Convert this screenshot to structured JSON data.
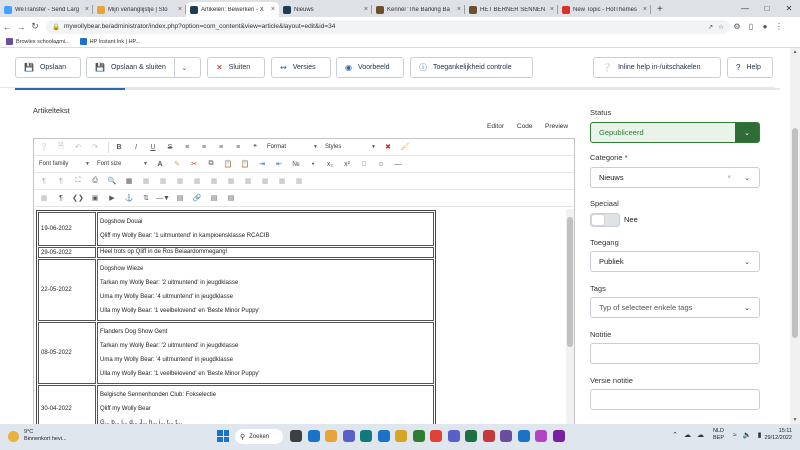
{
  "browser": {
    "tabs": [
      {
        "title": "WeTransfer - Send Larg",
        "color": "#409fff",
        "active": false
      },
      {
        "title": "Mijn verlanglijstje | Sto",
        "color": "#e8a33d",
        "active": false
      },
      {
        "title": "Artikelen: Bewerken - X",
        "color": "#1c3d5a",
        "active": true
      },
      {
        "title": "Nieuws",
        "color": "#1c3d5a",
        "active": false
      },
      {
        "title": "Kennel 'The Barking Ba",
        "color": "#6b4f2e",
        "active": false
      },
      {
        "title": "HET BERNER SENNEN",
        "color": "#6b4f2e",
        "active": false
      },
      {
        "title": "New Topic - HotThemes",
        "color": "#d93025",
        "active": false
      }
    ],
    "url": "mywollybear.be/administrator/index.php?option=com_content&view=article&layout=edit&id=34",
    "bookmarks": [
      {
        "label": "Browlex schoolaдmi...",
        "color": "#6b4f9e"
      },
      {
        "label": "HP Instant Ink | HP...",
        "color": "#1a73c8"
      }
    ]
  },
  "toolbar": {
    "save": "Opslaan",
    "save_close": "Opslaan & sluiten",
    "close": "Sluiten",
    "versions": "Versies",
    "preview": "Voorbeeld",
    "accessibility": "Toegankelijkheid controle",
    "inline_help": "Inline help in-/uitschakelen",
    "help": "Help"
  },
  "editor": {
    "section_label": "Artikeltekst",
    "view_tabs": [
      "Editor",
      "Code",
      "Preview"
    ],
    "format_select": "Format",
    "styles_select": "Styles",
    "font_family_select": "Font family",
    "font_size_select": "Font size"
  },
  "news": [
    {
      "date": "19-06-2022",
      "lines": [
        "Dogshow Douai",
        "Qliff my Wolly Bear: '1 uitmuntend' in kampioensklasse RCACIB"
      ]
    },
    {
      "date": "29-05-2022",
      "lines": [
        "Heel trots op Qliff in de Ros Beiaardommegang!"
      ]
    },
    {
      "date": "22-05-2022",
      "lines": [
        "Dogshow Wieze",
        "Tarkan my Wolly Bear: '2 uitmuntend' in jeugdklasse",
        "Uma my Wolly Bear: '4 uitmuntend' in jeugdklasse",
        "Ulla my Wolly Bear: '1 veelbelovend' en 'Beste Minor Puppy'"
      ]
    },
    {
      "date": "08-05-2022",
      "lines": [
        "Flanders Dog Show Gent",
        "Tarkan my Wolly Bear: '2 uitmuntend' in jeugdklasse",
        "Uma my Wolly Bear: '4 uitmuntend' in jeugdklasse",
        "Ulla my Wolly Bear: '1 veelbelovend' en 'Beste Minor Puppy'"
      ]
    },
    {
      "date": "30-04-2022",
      "lines": [
        "Belgische Sennenhonden Club: Fokselectie",
        "Qliff my Wolly Bear",
        "G... b... l... d... J... h... i... t... t..."
      ]
    }
  ],
  "sidebar": {
    "status_label": "Status",
    "status_value": "Gepubliceerd",
    "category_label": "Categorie *",
    "category_value": "Nieuws",
    "featured_label": "Speciaal",
    "featured_value": "Nee",
    "access_label": "Toegang",
    "access_value": "Publiek",
    "tags_label": "Tags",
    "tags_placeholder": "Typ of selecteer enkele tags",
    "note_label": "Notitie",
    "version_note_label": "Versie notitie"
  },
  "taskbar": {
    "temperature": "9°C",
    "weather_text": "Binnenkort hevi...",
    "search": "Zoeken",
    "lang_top": "NLD",
    "lang_bottom": "BEP",
    "time": "15:11",
    "date": "29/12/2022",
    "app_colors": [
      "#3c4043",
      "#1a73c8",
      "#e8a33d",
      "#5b5fc7",
      "#0f7b7b",
      "#1a73c8",
      "#d6a526",
      "#2f7d32",
      "#db4437",
      "#5b5fc7",
      "#1d6f42",
      "#c5383b",
      "#6b4f9e",
      "#1a73c8",
      "#b146c2",
      "#7a1fa2"
    ]
  }
}
